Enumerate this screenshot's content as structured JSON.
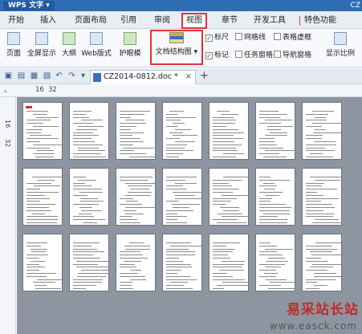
{
  "app": {
    "title": "WPS 文字",
    "title_right": "CZ"
  },
  "menu": {
    "items": [
      "开始",
      "插入",
      "页面布局",
      "引用",
      "审阅",
      "视图",
      "章节",
      "开发工具",
      "特色功能"
    ],
    "active": "视图"
  },
  "ribbon": {
    "buttons": [
      "页面",
      "全屏显示",
      "大纲",
      "Web版式",
      "护眼模",
      "文档结构图 ▾",
      "显示比例"
    ],
    "checkboxes": [
      {
        "label": "标尺",
        "checked": true
      },
      {
        "label": "网格线",
        "checked": false
      },
      {
        "label": "表格虚框",
        "checked": false
      },
      {
        "label": "标记",
        "checked": true
      },
      {
        "label": "任务窗格",
        "checked": false
      },
      {
        "label": "导航窗格",
        "checked": false
      }
    ]
  },
  "quickbar": {
    "doc_tab": "CZ2014-0812.doc *",
    "close": "×",
    "add": "+"
  },
  "ruler": {
    "top_nums": [
      "16",
      "32"
    ],
    "left_nums": [
      "16",
      "32"
    ]
  },
  "watermark": {
    "line1": "易采站长站",
    "line2": "www.easck.com"
  },
  "colors": {
    "title_bg": "#2f6db5",
    "highlight": "#e03434",
    "canvas_bg": "#8d95a0"
  }
}
